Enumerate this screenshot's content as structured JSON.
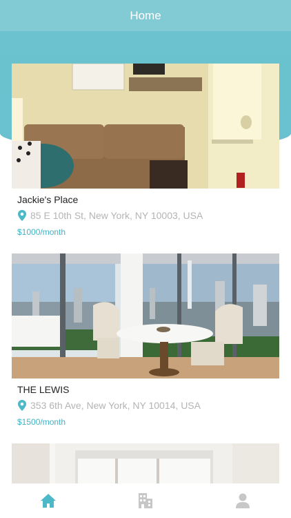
{
  "header": {
    "title": "Home"
  },
  "listings": [
    {
      "name": "Jackie's Place",
      "address": "85 E 10th St, New York, NY 10003, USA",
      "price": "$1000/month"
    },
    {
      "name": "THE LEWIS",
      "address": "353 6th Ave, New York, NY 10014, USA",
      "price": "$1500/month"
    }
  ],
  "tabbar": {
    "icons": [
      "home-icon",
      "building-icon",
      "profile-icon"
    ],
    "active_color": "#4cb8c8",
    "inactive_color": "#c7c7c7"
  },
  "colors": {
    "accent": "#6cc2cf",
    "price": "#3fb3c5"
  }
}
